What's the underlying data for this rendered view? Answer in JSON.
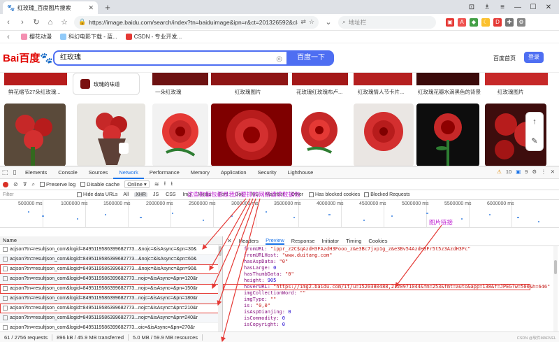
{
  "browser": {
    "tab_title": "红玫瑰_百度图片搜索",
    "new_tab": "+",
    "url": "https://image.baidu.com/search/index?tn=baiduimage&ipn=r&ct=201326592&cl=2...",
    "search_placeholder": "地址栏",
    "bookmarks": [
      "樱花动漫",
      "科幻电影下载 - 蓝...",
      "CSDN - 专业开发..."
    ]
  },
  "baidu": {
    "logo": "Bai百度",
    "query": "红玫瑰",
    "search_button": "百度一下",
    "home_link": "百度首页",
    "login_button": "登录",
    "suggest": "玫瑰的味道",
    "captions": [
      "鲜花缩节27朵红玫瑰...",
      "一朵红玫瑰",
      "红玫瑰图片",
      "花玫瑰红玫瑰布卢...",
      "红玫瑰情人节卡片...",
      "红玫瑰花瓣水滴黑色的背景",
      "红玫瑰图片"
    ]
  },
  "devtools": {
    "tabs": [
      "Elements",
      "Console",
      "Sources",
      "Network",
      "Performance",
      "Memory",
      "Application",
      "Security",
      "Lighthouse"
    ],
    "active_tab": "Network",
    "warnings": "10",
    "errors": "9",
    "toolbar": {
      "preserve_log": "Preserve log",
      "disable_cache": "Disable cache",
      "throttle": "Online"
    },
    "filter": {
      "placeholder": "Filter",
      "hide_data_urls": "Hide data URLs",
      "types": [
        "All",
        "XHR",
        "JS",
        "CSS",
        "Img",
        "Media",
        "Font",
        "Doc",
        "WS",
        "Manifest",
        "Other"
      ],
      "active_type": "XHR",
      "blocked_cookies": "Has blocked cookies",
      "blocked_requests": "Blocked Requests"
    },
    "timeline_ticks": [
      "500000 ms",
      "1000000 ms",
      "1500000 ms",
      "2000000 ms",
      "2500000 ms",
      "3000000 ms",
      "3500000 ms",
      "4000000 ms",
      "4500000 ms",
      "5000000 ms",
      "5500000 ms",
      "6000000 ms"
    ],
    "list_header": "Name",
    "requests": [
      "acjson?tn=resultjson_com&logid=8495119586399682773...&nojc=&isAsync=&pn=30&",
      "acjson?tn=resultjson_com&logid=8495119586399682773...&nojc=&isAsync=&pn=60&",
      "acjson?tn=resultjson_com&logid=8495119586399682773...&nojc=&isAsync=&pn=90&",
      "acjson?tn=resultjson_com&logid=8495119586399682773...nojc=&isAsync=&pn=120&r",
      "acjson?tn=resultjson_com&logid=8495119586399682773...nojc=&isAsync=&pn=150&r",
      "acjson?tn=resultjson_com&logid=8495119586399682773...nojc=&isAsync=&pn=180&r",
      "acjson?tn=resultjson_com&logid=8495119586399682773...nojc=&isAsync=&pn=210&r",
      "acjson?tn=resultjson_com&logid=8495119586399682773...nojc=&isAsync=&pn=240&r",
      "acjson?tn=resultjson_com&logid=8495119586399682773...oic=&isAsync=&pn=270&r"
    ],
    "detail_tabs": [
      "Headers",
      "Preview",
      "Response",
      "Initiator",
      "Timing",
      "Cookies"
    ],
    "detail_active": "Preview",
    "detail_lines": [
      {
        "k": "fromURL",
        "v": "\"ippr_z2C$qAzdH3FAzdH3Fooo_z&e3Bc7jvp1g_z&e3Bv54AzdH3Fr5t5z3AzdH3Fc\"",
        "t": "s"
      },
      {
        "k": "fromURLHost",
        "v": "\"www.duitang.com\"",
        "t": "s"
      },
      {
        "k": "hasAspData",
        "v": "\"0\"",
        "t": "s"
      },
      {
        "k": "hasLarge",
        "v": "0",
        "t": "n"
      },
      {
        "k": "hasThumbData",
        "v": "\"0\"",
        "t": "s"
      },
      {
        "k": "height",
        "v": "905",
        "t": "n"
      },
      {
        "k": "hoverURL",
        "v": "\"https://img2.baidu.com/it/u=1520380488,2120971044&fm=253&fmt=auto&app=138&f=JPEG?w=500&h=646\"",
        "t": "s"
      },
      {
        "k": "imgCollectionWord",
        "v": "\"\"",
        "t": "s"
      },
      {
        "k": "imgType",
        "v": "\"\"",
        "t": "s"
      },
      {
        "k": "is",
        "v": "\"0,0\"",
        "t": "s"
      },
      {
        "k": "isAspDianjing",
        "v": "0",
        "t": "n"
      },
      {
        "k": "isCommodity",
        "v": "0",
        "t": "n"
      },
      {
        "k": "isCopyright",
        "v": "0",
        "t": "n"
      }
    ],
    "status": {
      "requests": "61 / 2756 requests",
      "transferred": "896 kB / 45.9 MB transferred",
      "resources": "5.0 MB / 59.9 MB resources"
    }
  },
  "annotations": {
    "packets": "这些数据包都是我们要抓的网络请求数据包",
    "img_link": "图片链接"
  },
  "watermark": "CSDN @软件MARVEL"
}
